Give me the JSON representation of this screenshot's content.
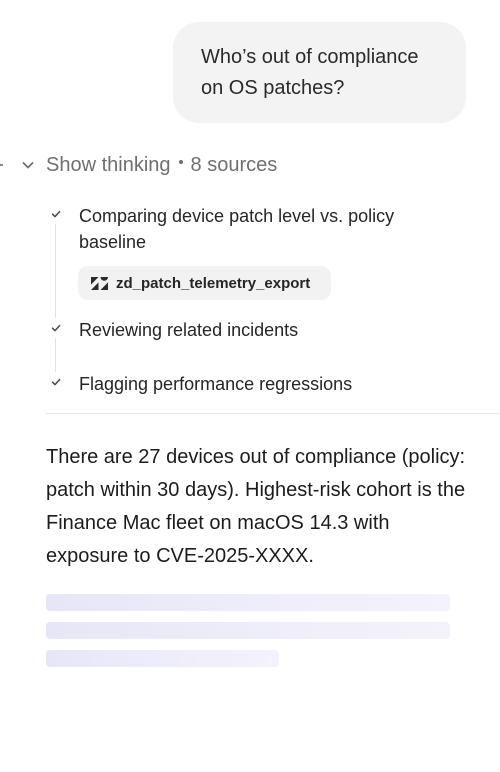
{
  "user_message": {
    "line1": "Who’s out of compliance",
    "line2": "on OS patches?"
  },
  "thinking": {
    "toggle_label": "Show thinking",
    "sources_label": "8 sources",
    "toggle_icon": "chevron-down-icon",
    "steps": [
      {
        "label": "Comparing device patch level vs. policy baseline",
        "icon": "check-icon"
      },
      {
        "label": "Reviewing related incidents",
        "icon": "check-icon"
      },
      {
        "label": "Flagging performance regressions",
        "icon": "check-icon"
      }
    ],
    "source_chip": {
      "label": "zd_patch_telemetry_export",
      "icon": "zendesk-logo-icon"
    }
  },
  "answer": {
    "text": "There are 27 devices out of compliance (policy: patch within 30 days). Highest-risk cohort is the Finance Mac fleet on macOS 14.3 with exposure to CVE-2025-XXXX."
  },
  "loading": {
    "state": "streaming"
  },
  "colors": {
    "bubble_bg": "#f3f3f3",
    "muted_text": "#6f6f6f",
    "skeleton": "#e6e6f8"
  }
}
